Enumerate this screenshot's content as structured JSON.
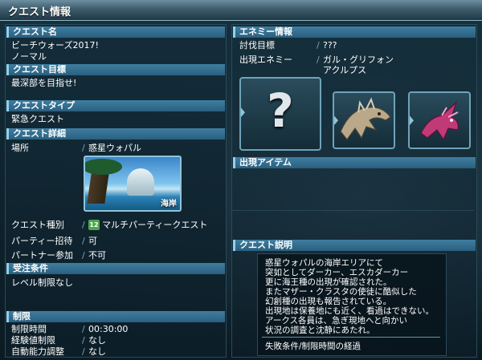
{
  "window": {
    "title": "クエスト情報"
  },
  "left": {
    "quest_name": {
      "header": "クエスト名",
      "line1": "ビーチウォーズ2017!",
      "line2": "ノーマル"
    },
    "quest_goal": {
      "header": "クエスト目標",
      "text": "最深部を目指せ!"
    },
    "quest_type": {
      "header": "クエストタイプ",
      "text": "緊急クエスト"
    },
    "quest_detail": {
      "header": "クエスト詳細",
      "location_label": "場所",
      "location_value": "惑星ウォパル",
      "thumb_label": "海岸",
      "category_label": "クエスト種別",
      "category_badge": "12",
      "category_value": "マルチパーティークエスト",
      "party_invite_label": "パーティー招待",
      "party_invite_value": "可",
      "partner_label": "パートナー参加",
      "partner_value": "不可"
    },
    "order_conditions": {
      "header": "受注条件",
      "text": "レベル制限なし"
    },
    "restrictions": {
      "header": "制限",
      "time_label": "制限時間",
      "time_value": "00:30:00",
      "exp_label": "経験値制限",
      "exp_value": "なし",
      "auto_label": "自動能力調整",
      "auto_value": "なし"
    }
  },
  "right": {
    "enemy_info": {
      "header": "エネミー情報",
      "target_label": "討伐目標",
      "target_value": "???",
      "appear_label": "出現エネミー",
      "appear_value_1": "ガル・グリフォン",
      "appear_value_2": "アクルプス",
      "icons": [
        "unknown-enemy-icon",
        "gal-griffon-icon",
        "acrupus-icon"
      ]
    },
    "items": {
      "header": "出現アイテム"
    },
    "description": {
      "header": "クエスト説明",
      "lines": [
        "惑星ウォパルの海岸エリアにて",
        "突如としてダーカー、エスカダーカー",
        "更に海王種の出現が確認された。",
        "またマザー・クラスタの使徒に酷似した",
        "幻創種の出現も報告されている。",
        "出現地は保養地にも近く、看過はできない。",
        "アークス各員は、急ぎ現地へと向かい",
        "状況の調査と沈静にあたれ。"
      ],
      "fail_condition": "失敗条件/制限時間の経過"
    }
  },
  "colors": {
    "header_blue": "#2a5f7f",
    "accent": "#8fd1ee",
    "badge_green": "#4aa84a"
  }
}
